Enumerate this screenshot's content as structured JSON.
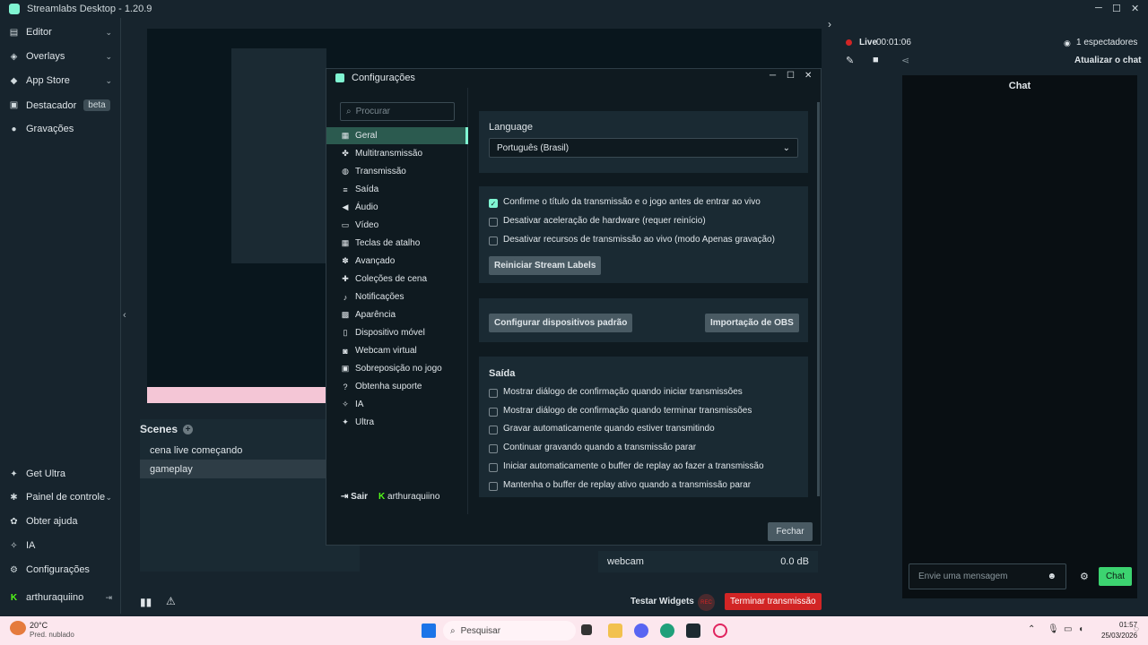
{
  "window": {
    "title": "Streamlabs Desktop - 1.20.9"
  },
  "nav_top": [
    {
      "label": "Editor",
      "icon": "editor-icon",
      "chevron": true
    },
    {
      "label": "Overlays",
      "icon": "overlays-icon",
      "chevron": true
    },
    {
      "label": "App Store",
      "icon": "app-store-icon",
      "chevron": true
    },
    {
      "label": "Destacador",
      "icon": "highlighter-icon",
      "badge": "beta"
    },
    {
      "label": "Gravações",
      "icon": "recordings-icon"
    }
  ],
  "nav_bottom": [
    {
      "label": "Get Ultra",
      "icon": "ultra-icon"
    },
    {
      "label": "Painel de controle",
      "icon": "dashboard-icon",
      "chevron": true
    },
    {
      "label": "Obter ajuda",
      "icon": "help-icon"
    },
    {
      "label": "IA",
      "icon": "ai-icon"
    },
    {
      "label": "Configurações",
      "icon": "gear-icon"
    },
    {
      "label": "arthuraquiino",
      "icon": "kick-icon"
    }
  ],
  "scenes": {
    "title": "Scenes",
    "items": [
      "cena live começando",
      "gameplay"
    ],
    "active": "gameplay"
  },
  "mixer": {
    "source": "webcam",
    "level": "0.0 dB"
  },
  "bottom": {
    "test_widgets": "Testar Widgets",
    "rec": "REC",
    "end_stream": "Terminar transmissão"
  },
  "live": {
    "status": "Live",
    "time": "00:01:06",
    "viewers": "1 espectadores",
    "refresh_chat": "Atualizar o chat"
  },
  "chat": {
    "title": "Chat",
    "placeholder": "Envie uma mensagem",
    "send": "Chat"
  },
  "settings": {
    "title": "Configurações",
    "search_placeholder": "Procurar",
    "menu": [
      {
        "label": "Geral",
        "icon": "grid-icon",
        "active": true
      },
      {
        "label": "Multitransmissão",
        "icon": "multistream-icon"
      },
      {
        "label": "Transmissão",
        "icon": "globe-icon"
      },
      {
        "label": "Saída",
        "icon": "output-icon"
      },
      {
        "label": "Áudio",
        "icon": "speaker-icon"
      },
      {
        "label": "Vídeo",
        "icon": "monitor-icon"
      },
      {
        "label": "Teclas de atalho",
        "icon": "hotkeys-icon"
      },
      {
        "label": "Avançado",
        "icon": "cogs-icon"
      },
      {
        "label": "Coleções de cena",
        "icon": "collections-icon"
      },
      {
        "label": "Notificações",
        "icon": "bell-icon"
      },
      {
        "label": "Aparência",
        "icon": "palette-icon"
      },
      {
        "label": "Dispositivo móvel",
        "icon": "phone-icon"
      },
      {
        "label": "Webcam virtual",
        "icon": "camera-icon"
      },
      {
        "label": "Sobreposição no jogo",
        "icon": "overlay-icon"
      },
      {
        "label": "Obtenha suporte",
        "icon": "question-icon"
      },
      {
        "label": "IA",
        "icon": "ai-icon"
      },
      {
        "label": "Ultra",
        "icon": "ultra-icon"
      }
    ],
    "logout": "Sair",
    "username": "arthuraquiino",
    "language_label": "Language",
    "language_value": "Português (Brasil)",
    "general_checks": [
      {
        "label": "Confirme o título da transmissão e o jogo antes de entrar ao vivo",
        "checked": true
      },
      {
        "label": "Desativar aceleração de hardware (requer reinício)",
        "checked": false
      },
      {
        "label": "Desativar recursos de transmissão ao vivo (modo Apenas gravação)",
        "checked": false
      }
    ],
    "reset_labels": "Reiniciar Stream Labels",
    "config_devices": "Configurar dispositivos padrão",
    "obs_import": "Importação de OBS",
    "output_title": "Saída",
    "output_checks": [
      {
        "label": "Mostrar diálogo de confirmação quando iniciar transmissões",
        "checked": false
      },
      {
        "label": "Mostrar diálogo de confirmação quando terminar transmissões",
        "checked": false
      },
      {
        "label": "Gravar automaticamente quando estiver transmitindo",
        "checked": false
      },
      {
        "label": "Continuar gravando quando a transmissão parar",
        "checked": false
      },
      {
        "label": "Iniciar automaticamente o buffer de replay ao fazer a transmissão",
        "checked": false
      },
      {
        "label": "Mantenha o buffer de replay ativo quando a transmissão parar",
        "checked": false
      }
    ],
    "close": "Fechar"
  },
  "taskbar": {
    "weather_temp": "20°C",
    "weather_desc": "Pred. nublado",
    "search_placeholder": "Pesquisar",
    "time": "01:57",
    "date": "25/03/2026"
  },
  "colors": {
    "accent": "#80f5d2",
    "live": "#d22525",
    "chat_button": "#3cd370"
  }
}
